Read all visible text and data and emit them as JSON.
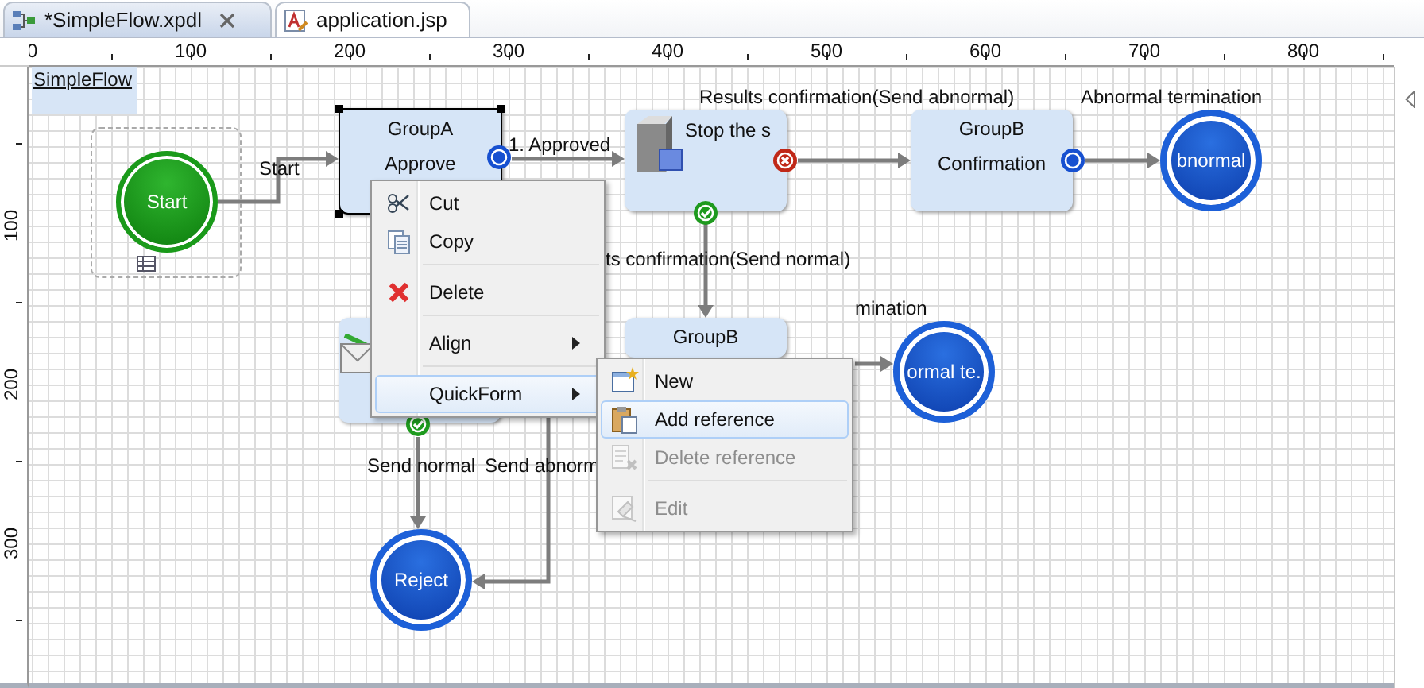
{
  "tabs": [
    {
      "label": "*SimpleFlow.xpdl",
      "selected": true,
      "closable": true
    },
    {
      "label": "application.jsp",
      "selected": false,
      "closable": false
    }
  ],
  "ruler": {
    "top_labels": [
      "0",
      "100",
      "200",
      "300",
      "400",
      "500",
      "600",
      "700",
      "800"
    ],
    "left_labels": [
      "100",
      "200",
      "300"
    ]
  },
  "diagram": {
    "title": "SimpleFlow",
    "nodes": [
      {
        "kind": "start",
        "label": "Start",
        "selected": false
      },
      {
        "kind": "activity",
        "lines": [
          "GroupA",
          "Approve"
        ],
        "selected": true
      },
      {
        "kind": "activity",
        "lines": [
          "Stop the s"
        ],
        "selected": false
      },
      {
        "kind": "activity",
        "lines": [
          "GroupB",
          "Confirmation"
        ],
        "selected": false
      },
      {
        "kind": "end",
        "label": "bnormal",
        "selected": false
      },
      {
        "kind": "activity",
        "selected": false
      },
      {
        "kind": "activity",
        "lines": [
          "GroupB"
        ],
        "selected": false
      },
      {
        "kind": "end",
        "label": "ormal te.",
        "selected": false
      },
      {
        "kind": "end",
        "label": "Reject",
        "selected": false
      }
    ],
    "edge_labels": [
      "Start",
      "1. Approved",
      "Results confirmation(Send abnormal)",
      "Abnormal termination",
      "ts confirmation(Send normal)",
      "mination",
      "Send normal",
      "Send abnorm"
    ]
  },
  "context_menu": {
    "items": [
      {
        "label": "Cut",
        "submenu": false,
        "highlighted": false,
        "disabled": false,
        "separator_after": false
      },
      {
        "label": "Copy",
        "submenu": false,
        "highlighted": false,
        "disabled": false,
        "separator_after": true
      },
      {
        "label": "Delete",
        "submenu": false,
        "highlighted": false,
        "disabled": false,
        "separator_after": true
      },
      {
        "label": "Align",
        "submenu": true,
        "highlighted": false,
        "disabled": false,
        "separator_after": true
      },
      {
        "label": "QuickForm",
        "submenu": true,
        "highlighted": true,
        "disabled": false,
        "separator_after": false
      }
    ]
  },
  "submenu": {
    "items": [
      {
        "label": "New",
        "submenu": false,
        "highlighted": false,
        "disabled": false,
        "separator_after": false
      },
      {
        "label": "Add reference",
        "submenu": false,
        "highlighted": true,
        "disabled": false,
        "separator_after": false
      },
      {
        "label": "Delete reference",
        "submenu": false,
        "highlighted": false,
        "disabled": true,
        "separator_after": true
      },
      {
        "label": "Edit",
        "submenu": false,
        "highlighted": false,
        "disabled": true,
        "separator_after": false
      }
    ]
  }
}
